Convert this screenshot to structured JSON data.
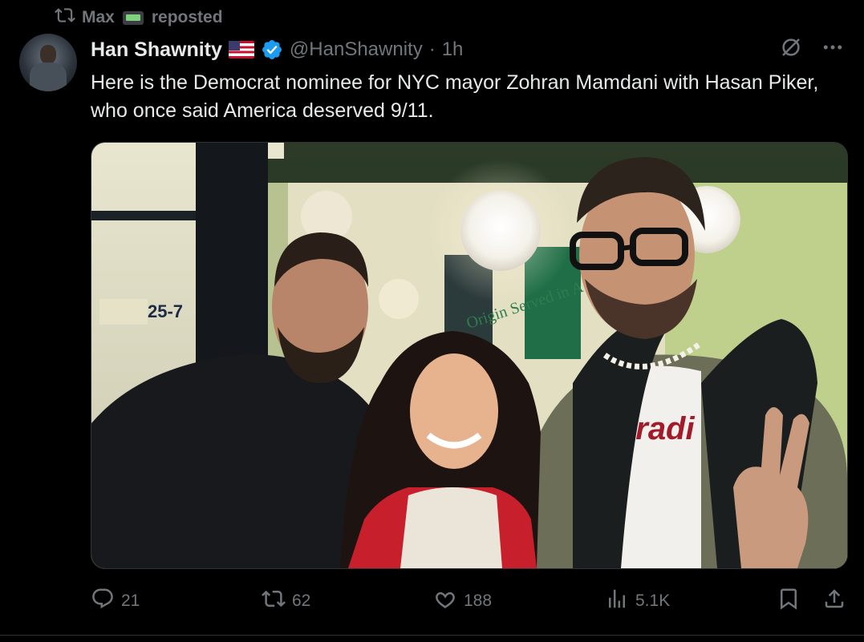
{
  "repost": {
    "user": "Max",
    "label": "reposted",
    "icon": "repost-icon"
  },
  "author": {
    "display_name": "Han Shawnity",
    "handle": "@HanShawnity",
    "separator": "·",
    "time": "1h",
    "badges": [
      "us-flag-emoji",
      "verified-badge-icon"
    ]
  },
  "tweet": {
    "text": "Here is the Democrat nominee for NYC mayor Zohran Mamdani with Hasan Piker, who once said America deserved 9/11."
  },
  "media": {
    "type": "photo",
    "sign_text": "25-7",
    "window_text": "Origin Served in A",
    "shirt_text": "aradi"
  },
  "actions": {
    "replies": "21",
    "reposts": "62",
    "likes": "188",
    "views": "5.1K"
  },
  "colors": {
    "background": "#000000",
    "text_primary": "#e7e9ea",
    "text_secondary": "#71767b",
    "verified": "#1d9bf0"
  }
}
